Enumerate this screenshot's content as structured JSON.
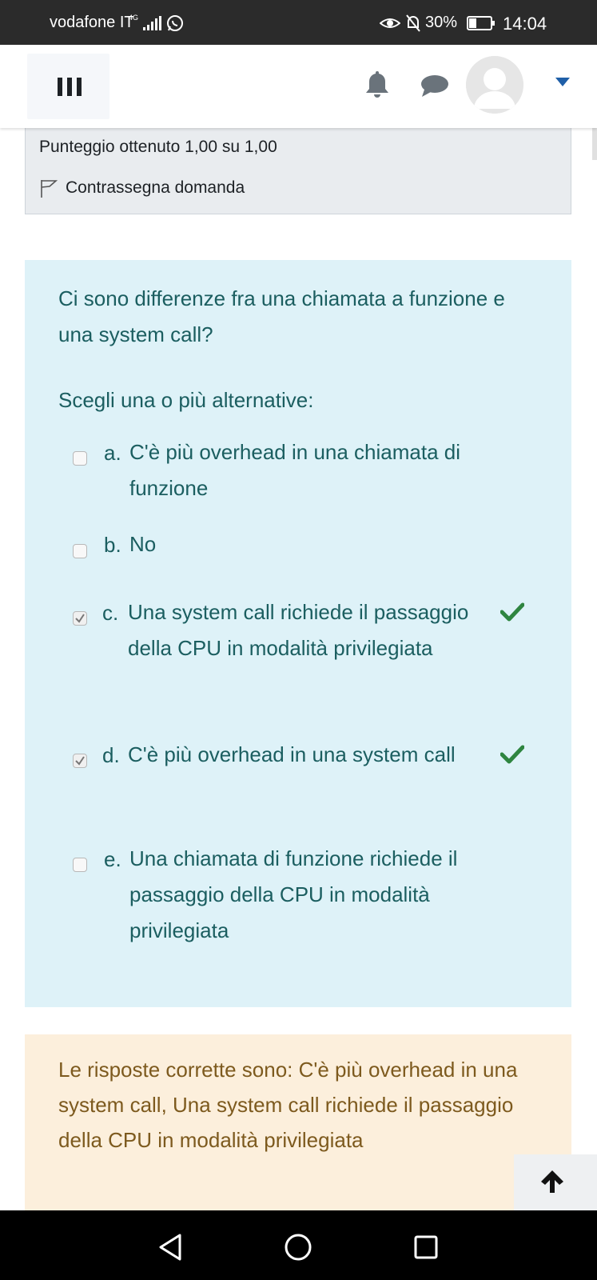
{
  "status_bar": {
    "carrier": "vodafone IT",
    "network": "4G",
    "battery_percent": "30%",
    "time": "14:04"
  },
  "app_bar": {
    "icons": [
      "menu-icon",
      "bell-icon",
      "chat-icon",
      "avatar",
      "chevron-down-icon"
    ]
  },
  "question_info": {
    "score": "Punteggio ottenuto 1,00 su 1,00",
    "flag_label": "Contrassegna domanda"
  },
  "question": {
    "text": "Ci sono differenze fra una chiamata a funzione e una system call?",
    "prompt": "Scegli una o più alternative:",
    "options": [
      {
        "letter": "a.",
        "text": "C'è più overhead in una chiamata di funzione",
        "checked": false,
        "correct_mark": false
      },
      {
        "letter": "b.",
        "text": "No",
        "checked": false,
        "correct_mark": false
      },
      {
        "letter": "c.",
        "text": "Una system call richiede il passaggio della CPU in modalità privilegiata",
        "checked": true,
        "correct_mark": true
      },
      {
        "letter": "d.",
        "text": "C'è più overhead in una system call",
        "checked": true,
        "correct_mark": true
      },
      {
        "letter": "e.",
        "text": "Una chiamata di funzione richiede il passaggio della CPU in modalità privilegiata",
        "checked": false,
        "correct_mark": false
      }
    ]
  },
  "feedback": {
    "text": "Le risposte corrette sono: C'è più overhead in una system call, Una system call richiede il passaggio della CPU in modalità privilegiata"
  },
  "colors": {
    "question_bg": "#def2f8",
    "question_text": "#1b5e60",
    "feedback_bg": "#fcefdc",
    "feedback_text": "#7d5a1e",
    "correct_tick": "#2e8540"
  }
}
